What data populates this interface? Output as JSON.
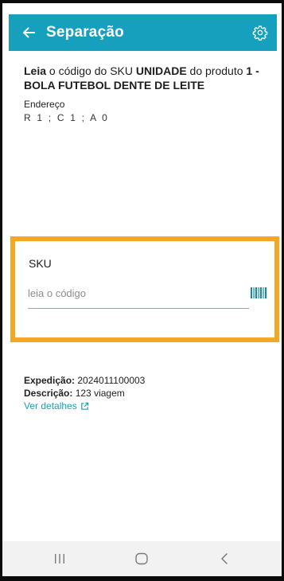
{
  "header": {
    "title": "Separação",
    "back_icon": "arrow-left-icon",
    "settings_icon": "gear-icon",
    "background_color": "#17a0bd"
  },
  "instruction": {
    "prefix_bold": "Leia",
    "middle": " o código do SKU ",
    "unit_bold": "UNIDADE",
    "after_unit": " do produto ",
    "product_bold": "1 - BOLA FUTEBOL DENTE DE LEITE"
  },
  "address": {
    "label": "Endereço",
    "value": "R 1 ; C 1 ; A 0"
  },
  "sku": {
    "label": "SKU",
    "placeholder": "leia o código",
    "value": "",
    "scan_icon": "barcode-icon",
    "highlight_color": "#f5a623"
  },
  "details": {
    "expedition_label": "Expedição:",
    "expedition_value": " 2024011100003",
    "description_label": "Descrição:",
    "description_value": " 123 viagem",
    "link_label": "Ver detalhes",
    "link_icon": "external-link-icon"
  },
  "navbar": {
    "recents_icon": "recents-icon",
    "home_icon": "home-icon",
    "back_icon": "back-chevron-icon"
  }
}
